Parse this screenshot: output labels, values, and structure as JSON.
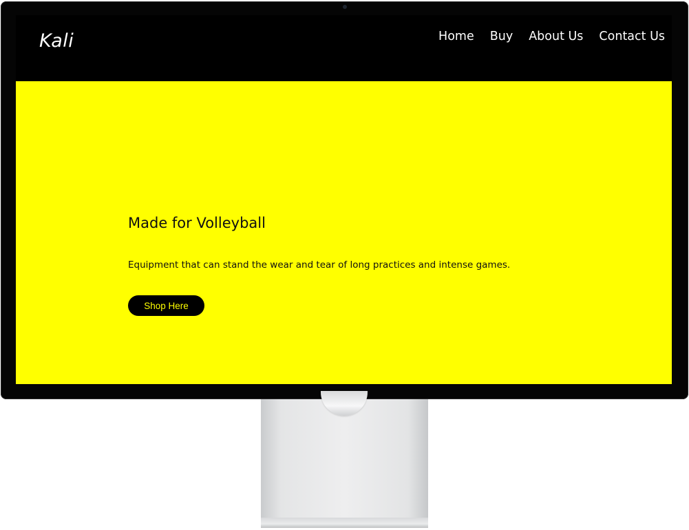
{
  "site": {
    "brand": "Kali"
  },
  "nav": {
    "items": [
      {
        "label": "Home"
      },
      {
        "label": "Buy"
      },
      {
        "label": "About Us"
      },
      {
        "label": "Contact Us"
      }
    ]
  },
  "hero": {
    "title": "Made for Volleyball",
    "subtitle": "Equipment that can stand the wear and tear of long practices and intense games.",
    "button_label": "Shop Here"
  },
  "colors": {
    "accent": "#ffff00",
    "navbar": "#000000",
    "bezel": "#050505"
  }
}
